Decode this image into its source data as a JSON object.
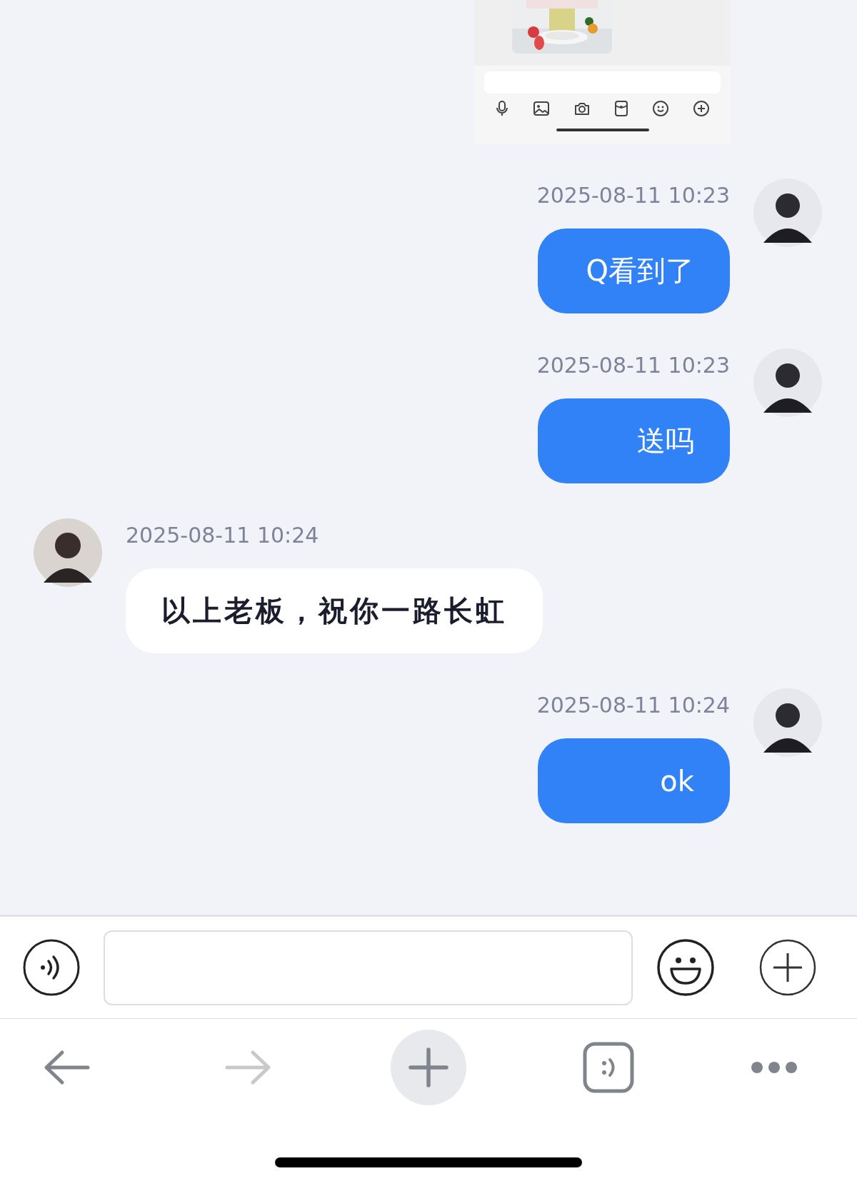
{
  "messages": [
    {
      "kind": "self",
      "time": "2025-08-11 10:23",
      "text": "Q看到了"
    },
    {
      "kind": "self",
      "time": "2025-08-11 10:23",
      "text": "送吗"
    },
    {
      "kind": "other",
      "time": "2025-08-11 10:24",
      "text": "以上老板，祝你一路长虹"
    },
    {
      "kind": "self",
      "time": "2025-08-11 10:24",
      "text": "ok"
    }
  ],
  "toolbar": {
    "back_disabled": false,
    "forward_disabled": true
  }
}
